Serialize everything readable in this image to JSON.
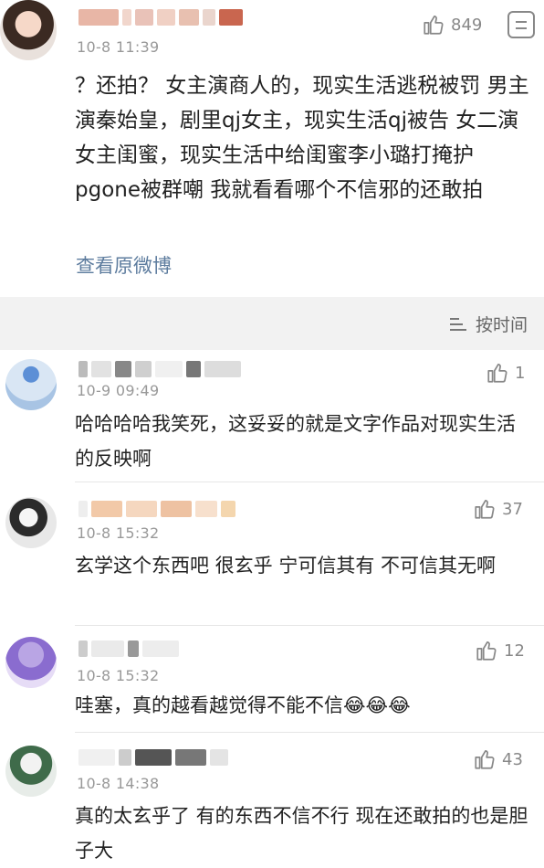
{
  "main_post": {
    "time": "10-8 11:39",
    "like_count": "849",
    "text": "？还拍？ 女主演商人的，现实生活逃税被罚 男主演秦始皇，剧里qj女主，现实生活qj被告 女二演女主闺蜜，现实生活中给闺蜜李小璐打掩护pgone被群嘲 我就看看哪个不信邪的还敢拍",
    "view_original": "查看原微博"
  },
  "sort": {
    "label": "按时间",
    "icon": "sort-icon"
  },
  "comments": [
    {
      "time": "10-9 09:49",
      "likes": "1",
      "text": "哈哈哈哈我笑死，这妥妥的就是文字作品对现实生活的反映啊"
    },
    {
      "time": "10-8 15:32",
      "likes": "37",
      "text": "玄学这个东西吧 很玄乎 宁可信其有 不可信其无啊"
    },
    {
      "time": "10-8 15:32",
      "likes": "12",
      "text": "哇塞，真的越看越觉得不能不信😂😂😂"
    },
    {
      "time": "10-8 14:38",
      "likes": "43",
      "text": "真的太玄乎了 有的东西不信不行 现在还敢拍的也是胆子大"
    }
  ],
  "colors": {
    "link": "#5d7c9e",
    "muted": "#999999",
    "background": "#f2f2f2"
  }
}
